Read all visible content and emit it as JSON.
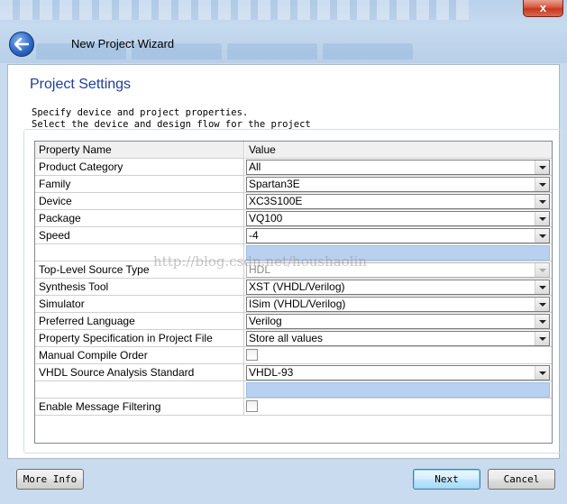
{
  "window": {
    "title": "New Project Wizard",
    "close_label": "x"
  },
  "page": {
    "heading": "Project Settings",
    "description_1": "Specify device and project properties.",
    "description_2": "Select the device and design flow for the project",
    "watermark": "http://blog.csdn.net/houshaolin"
  },
  "grid": {
    "header_name": "Property Name",
    "header_value": "Value",
    "rows": [
      {
        "name": "Product Category",
        "value": "All",
        "kind": "combo"
      },
      {
        "name": "Family",
        "value": "Spartan3E",
        "kind": "combo"
      },
      {
        "name": "Device",
        "value": "XC3S100E",
        "kind": "combo"
      },
      {
        "name": "Package",
        "value": "VQ100",
        "kind": "combo"
      },
      {
        "name": "Speed",
        "value": "-4",
        "kind": "combo"
      },
      {
        "name": "",
        "value": "",
        "kind": "blank"
      },
      {
        "name": "Top-Level Source Type",
        "value": "HDL",
        "kind": "combo-disabled"
      },
      {
        "name": "Synthesis Tool",
        "value": "XST (VHDL/Verilog)",
        "kind": "combo"
      },
      {
        "name": "Simulator",
        "value": "ISim (VHDL/Verilog)",
        "kind": "combo"
      },
      {
        "name": "Preferred Language",
        "value": "Verilog",
        "kind": "combo"
      },
      {
        "name": "Property Specification in Project File",
        "value": "Store all values",
        "kind": "combo"
      },
      {
        "name": "Manual Compile Order",
        "value": "",
        "kind": "checkbox"
      },
      {
        "name": "VHDL Source Analysis Standard",
        "value": "VHDL-93",
        "kind": "combo"
      },
      {
        "name": "",
        "value": "",
        "kind": "blank"
      },
      {
        "name": "Enable Message Filtering",
        "value": "",
        "kind": "checkbox"
      }
    ]
  },
  "buttons": {
    "more_info": "More Info",
    "next": "Next",
    "cancel": "Cancel"
  }
}
